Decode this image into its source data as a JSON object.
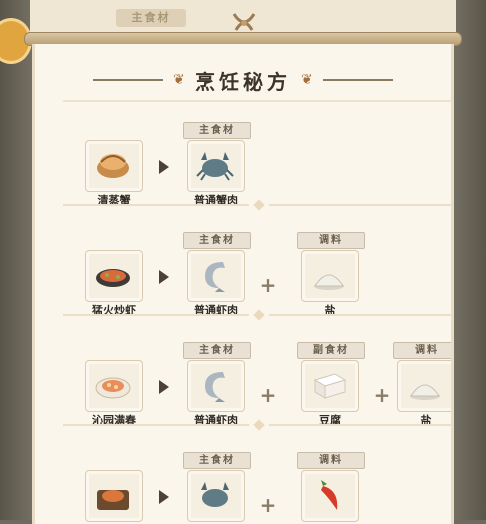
{
  "header": {
    "title": "烹饪秘方",
    "background_tag": "主食材"
  },
  "labels": {
    "main_ingredient": "主食材",
    "side_ingredient": "副食材",
    "seasoning": "调料"
  },
  "recipes": [
    {
      "dish": {
        "name": "清蒸蟹",
        "icon": "steamed-crab-icon"
      },
      "main": {
        "name": "普通蟹肉",
        "icon": "crab-icon"
      },
      "extras": []
    },
    {
      "dish": {
        "name": "猛火炒虾",
        "icon": "fried-shrimp-icon"
      },
      "main": {
        "name": "普通虾肉",
        "icon": "shrimp-icon"
      },
      "extras": [
        {
          "type": "调料",
          "name": "盐",
          "icon": "salt-icon"
        }
      ]
    },
    {
      "dish": {
        "name": "沁园满春",
        "icon": "spring-dish-icon"
      },
      "main": {
        "name": "普通虾肉",
        "icon": "shrimp-icon"
      },
      "extras": [
        {
          "type": "副食材",
          "name": "豆腐",
          "icon": "tofu-icon"
        },
        {
          "type": "调料",
          "name": "盐",
          "icon": "salt-icon"
        }
      ]
    },
    {
      "dish": {
        "name": "",
        "icon": "roasted-crab-dish-icon"
      },
      "main": {
        "name": "",
        "icon": "crab-icon"
      },
      "extras": [
        {
          "type": "调料",
          "name": "",
          "icon": "chili-icon"
        }
      ]
    }
  ],
  "colors": {
    "paper": "#fbf6ec",
    "accent_ornament": "#a36d3c",
    "tag_bg": "#e8e1d4"
  }
}
